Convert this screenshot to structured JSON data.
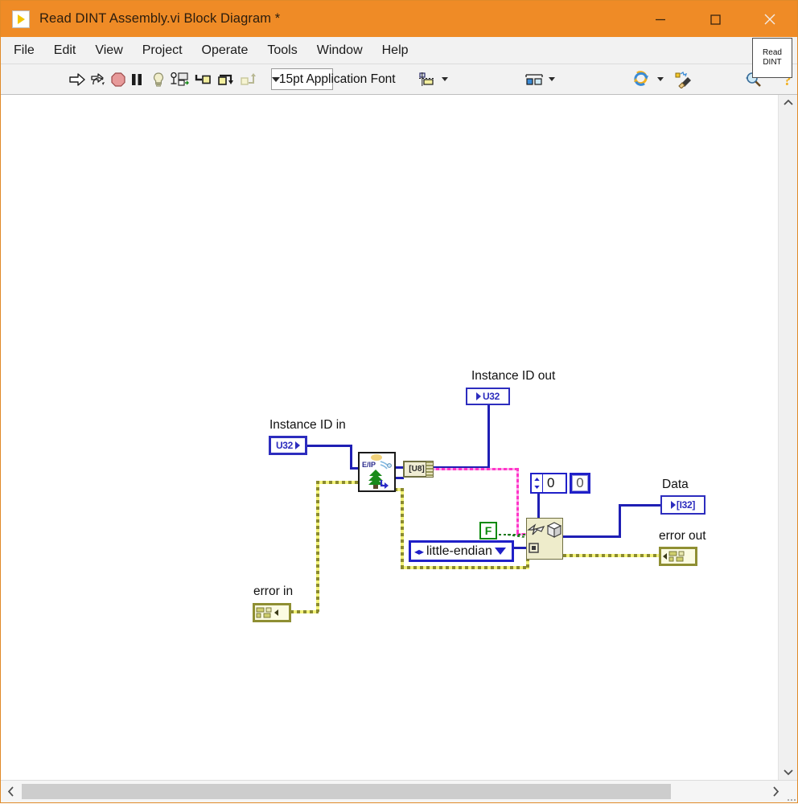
{
  "window": {
    "title": "Read DINT Assembly.vi Block Diagram *",
    "icon": "labview-vi-icon",
    "controls": {
      "minimize": "minimize-icon",
      "maximize": "maximize-icon",
      "close": "close-icon"
    }
  },
  "menubar": {
    "items": [
      "File",
      "Edit",
      "View",
      "Project",
      "Operate",
      "Tools",
      "Window",
      "Help"
    ]
  },
  "toolbar": {
    "icons": [
      "run-arrow-icon",
      "run-continuously-icon",
      "abort-execution-icon",
      "pause-icon",
      "highlight-execution-icon",
      "retain-wire-values-icon",
      "step-into-icon",
      "step-over-icon",
      "step-out-icon"
    ],
    "font_selector": {
      "value": "15pt Application Font",
      "arrow": "chevron-down-icon"
    },
    "align_objects": "align-objects-icon",
    "distribute_objects": "distribute-objects-icon",
    "resize_objects": "resize-objects-icon",
    "reorder": "reorder-objects-icon",
    "clean_up_diagram": "clean-up-diagram-icon",
    "search": "search-icon",
    "help": "context-help-icon",
    "vi_icon": {
      "line1": "Read",
      "line2": "DINT"
    }
  },
  "diagram": {
    "labels": {
      "instance_id_in": "Instance ID in",
      "instance_id_out": "Instance ID out",
      "data": "Data",
      "error_in": "error in",
      "error_out": "error out"
    },
    "terminals": {
      "instance_id_in_type": "U32",
      "instance_id_out_type": "U32",
      "data_type": "[I32]",
      "error_in_type": "error-cluster",
      "error_out_type": "error-cluster"
    },
    "nodes": {
      "ethernet_ip_vi": {
        "name": "EtherNet/IP Read Assembly VI",
        "badge": "E/IP"
      },
      "u8_array_node": {
        "label": "[U8]"
      },
      "unflatten_from_string": {
        "name": "Unflatten From String"
      }
    },
    "constants": {
      "boolean_false": "F",
      "byte_order_enum": "little-endian",
      "numeric_control": "0",
      "numeric_indicator": "0"
    },
    "colors": {
      "wire_numeric": "#1f1fb4",
      "wire_string": "#ff36c8",
      "wire_error": "#8a8a2e",
      "wire_boolean": "#1f7a1f",
      "accent_titlebar": "#ef8b26",
      "node_fill": "#eeeccb"
    }
  },
  "scrollbars": {
    "vertical": {
      "up": "chevron-up-icon",
      "down": "chevron-down-icon"
    },
    "horizontal": {
      "left": "chevron-left-icon",
      "right": "chevron-right-icon"
    }
  }
}
